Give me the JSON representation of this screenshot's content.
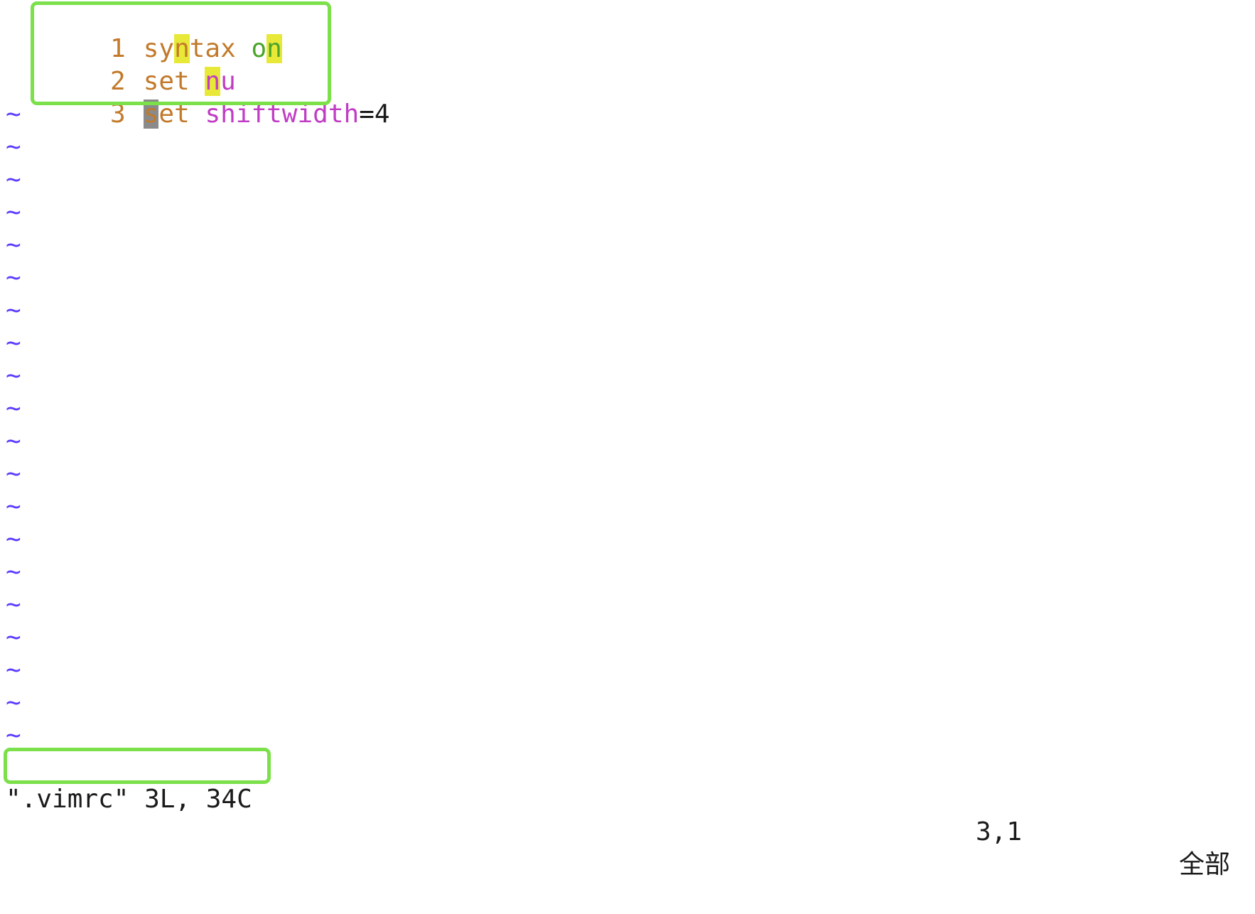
{
  "buffer": {
    "lines": [
      {
        "number": "1",
        "segments": [
          "sy",
          "n",
          "tax",
          " ",
          "o",
          "n"
        ]
      },
      {
        "number": "2",
        "segments": [
          "set",
          " ",
          "n",
          "u"
        ]
      },
      {
        "number": "3",
        "segments": [
          "s",
          "et",
          " ",
          "shiftwidth",
          "=4"
        ]
      }
    ],
    "empty_marker": "~"
  },
  "statusline": {
    "message": "\".vimrc\" 3L, 34C",
    "position": "3,1",
    "scroll": "全部"
  },
  "colors": {
    "keyword": "#c27a2a",
    "option": "#c03cc4",
    "value": "#4aa52a",
    "search_highlight": "#e8e838",
    "cursor": "#8a8a8a",
    "tilde": "#5a3cff",
    "annotation_box": "#7be04a"
  }
}
